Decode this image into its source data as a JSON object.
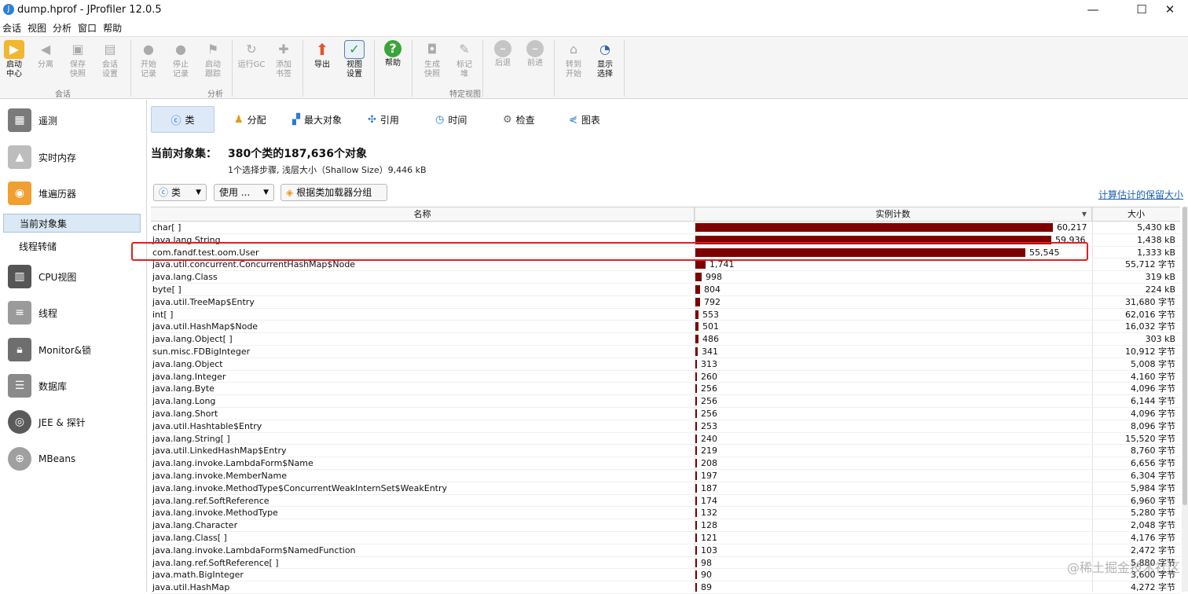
{
  "window": {
    "title": "dump.hprof - JProfiler 12.0.5",
    "min": "—",
    "max": "☐",
    "close": "✕"
  },
  "menu": [
    "会话",
    "视图",
    "分析",
    "窗口",
    "帮助"
  ],
  "toolbar": {
    "buttons": [
      {
        "label": "启动\n中心",
        "icon": "start-center-icon",
        "enabled": true
      },
      {
        "label": "分离",
        "icon": "detach-icon",
        "enabled": false
      },
      {
        "label": "保存\n快照",
        "icon": "save-snapshot-icon",
        "enabled": false
      },
      {
        "label": "会话\n设置",
        "icon": "session-settings-icon",
        "enabled": false
      },
      {
        "label": "开始\n记录",
        "icon": "start-recording-icon",
        "enabled": false
      },
      {
        "label": "停止\n记录",
        "icon": "stop-recording-icon",
        "enabled": false
      },
      {
        "label": "启动\n跟踪",
        "icon": "start-tracking-icon",
        "enabled": false
      },
      {
        "label": "运行GC",
        "icon": "run-gc-icon",
        "enabled": false
      },
      {
        "label": "添加\n书签",
        "icon": "add-bookmark-icon",
        "enabled": false
      },
      {
        "label": "导出",
        "icon": "export-icon",
        "enabled": true
      },
      {
        "label": "视图\n设置",
        "icon": "view-settings-icon",
        "enabled": true
      },
      {
        "label": "帮助",
        "icon": "help-icon",
        "enabled": true
      },
      {
        "label": "生成\n快照",
        "icon": "generate-snapshot-icon",
        "enabled": false
      },
      {
        "label": "标记\n堆",
        "icon": "mark-heap-icon",
        "enabled": false
      },
      {
        "label": "后退",
        "icon": "back-icon",
        "enabled": false
      },
      {
        "label": "前进",
        "icon": "forward-icon",
        "enabled": false
      },
      {
        "label": "转到\n开始",
        "icon": "go-to-start-icon",
        "enabled": false
      },
      {
        "label": "显示\n选择",
        "icon": "show-selection-icon",
        "enabled": true
      }
    ],
    "groups": [
      "会话",
      "分析",
      "特定视图"
    ]
  },
  "sidebar": {
    "items": [
      {
        "label": "遥测",
        "icon": "telemetry-icon"
      },
      {
        "label": "实时内存",
        "icon": "live-memory-icon"
      },
      {
        "label": "堆遍历器",
        "icon": "heap-walker-icon"
      },
      {
        "label": "CPU视图",
        "icon": "cpu-views-icon"
      },
      {
        "label": "线程",
        "icon": "threads-icon"
      },
      {
        "label": "Monitor&锁",
        "icon": "monitor-lock-icon"
      },
      {
        "label": "数据库",
        "icon": "database-icon"
      },
      {
        "label": "JEE & 探针",
        "icon": "jee-probes-icon"
      },
      {
        "label": "MBeans",
        "icon": "mbeans-icon"
      }
    ],
    "subitems": [
      {
        "label": "当前对象集",
        "selected": true
      },
      {
        "label": "线程转储",
        "selected": false
      }
    ]
  },
  "tabs": [
    {
      "label": "类",
      "icon": "class-icon",
      "selected": true
    },
    {
      "label": "分配",
      "icon": "allocation-icon",
      "selected": false
    },
    {
      "label": "最大对象",
      "icon": "biggest-objects-icon",
      "selected": false
    },
    {
      "label": "引用",
      "icon": "references-icon",
      "selected": false
    },
    {
      "label": "时间",
      "icon": "time-icon",
      "selected": false
    },
    {
      "label": "检查",
      "icon": "inspections-icon",
      "selected": false
    },
    {
      "label": "图表",
      "icon": "graph-icon",
      "selected": false
    }
  ],
  "object_set": {
    "title": "当前对象集：",
    "summary": "380个类的187,636个对象",
    "detail": "1个选择步骤, 浅层大小（Shallow Size）9,446 kB"
  },
  "controls": {
    "aggregation": "类",
    "use": "使用 ...",
    "group_by_classloader": "根据类加载器分组",
    "compute_retained": "计算估计的保留大小"
  },
  "table": {
    "columns": [
      "名称",
      "实例计数",
      "大小"
    ],
    "sort_indicator": "▼",
    "max_count": 60217,
    "rows": [
      {
        "name": "char[ ]",
        "count": "60,217",
        "value": 60217,
        "size": "5,430 kB"
      },
      {
        "name": "java.lang.String",
        "count": "59,936",
        "value": 59936,
        "size": "1,438 kB"
      },
      {
        "name": "com.fandf.test.oom.User",
        "count": "55,545",
        "value": 55545,
        "size": "1,333 kB"
      },
      {
        "name": "java.util.concurrent.ConcurrentHashMap$Node",
        "count": "1,741",
        "value": 1741,
        "size": "55,712 字节"
      },
      {
        "name": "java.lang.Class",
        "count": "998",
        "value": 998,
        "size": "319 kB"
      },
      {
        "name": "byte[ ]",
        "count": "804",
        "value": 804,
        "size": "224 kB"
      },
      {
        "name": "java.util.TreeMap$Entry",
        "count": "792",
        "value": 792,
        "size": "31,680 字节"
      },
      {
        "name": "int[ ]",
        "count": "553",
        "value": 553,
        "size": "62,016 字节"
      },
      {
        "name": "java.util.HashMap$Node",
        "count": "501",
        "value": 501,
        "size": "16,032 字节"
      },
      {
        "name": "java.lang.Object[ ]",
        "count": "486",
        "value": 486,
        "size": "303 kB"
      },
      {
        "name": "sun.misc.FDBigInteger",
        "count": "341",
        "value": 341,
        "size": "10,912 字节"
      },
      {
        "name": "java.lang.Object",
        "count": "313",
        "value": 313,
        "size": "5,008 字节"
      },
      {
        "name": "java.lang.Integer",
        "count": "260",
        "value": 260,
        "size": "4,160 字节"
      },
      {
        "name": "java.lang.Byte",
        "count": "256",
        "value": 256,
        "size": "4,096 字节"
      },
      {
        "name": "java.lang.Long",
        "count": "256",
        "value": 256,
        "size": "6,144 字节"
      },
      {
        "name": "java.lang.Short",
        "count": "256",
        "value": 256,
        "size": "4,096 字节"
      },
      {
        "name": "java.util.Hashtable$Entry",
        "count": "253",
        "value": 253,
        "size": "8,096 字节"
      },
      {
        "name": "java.lang.String[ ]",
        "count": "240",
        "value": 240,
        "size": "15,520 字节"
      },
      {
        "name": "java.util.LinkedHashMap$Entry",
        "count": "219",
        "value": 219,
        "size": "8,760 字节"
      },
      {
        "name": "java.lang.invoke.LambdaForm$Name",
        "count": "208",
        "value": 208,
        "size": "6,656 字节"
      },
      {
        "name": "java.lang.invoke.MemberName",
        "count": "197",
        "value": 197,
        "size": "6,304 字节"
      },
      {
        "name": "java.lang.invoke.MethodType$ConcurrentWeakInternSet$WeakEntry",
        "count": "187",
        "value": 187,
        "size": "5,984 字节"
      },
      {
        "name": "java.lang.ref.SoftReference",
        "count": "174",
        "value": 174,
        "size": "6,960 字节"
      },
      {
        "name": "java.lang.invoke.MethodType",
        "count": "132",
        "value": 132,
        "size": "5,280 字节"
      },
      {
        "name": "java.lang.Character",
        "count": "128",
        "value": 128,
        "size": "2,048 字节"
      },
      {
        "name": "java.lang.Class[ ]",
        "count": "121",
        "value": 121,
        "size": "4,176 字节"
      },
      {
        "name": "java.lang.invoke.LambdaForm$NamedFunction",
        "count": "103",
        "value": 103,
        "size": "2,472 字节"
      },
      {
        "name": "java.lang.ref.SoftReference[ ]",
        "count": "98",
        "value": 98,
        "size": "5,880 字节"
      },
      {
        "name": "java.math.BigInteger",
        "count": "90",
        "value": 90,
        "size": "3,600 字节"
      },
      {
        "name": "java.util.HashMap",
        "count": "89",
        "value": 89,
        "size": "4,272 字节"
      }
    ]
  },
  "watermark": "@稀土掘金技术社区"
}
